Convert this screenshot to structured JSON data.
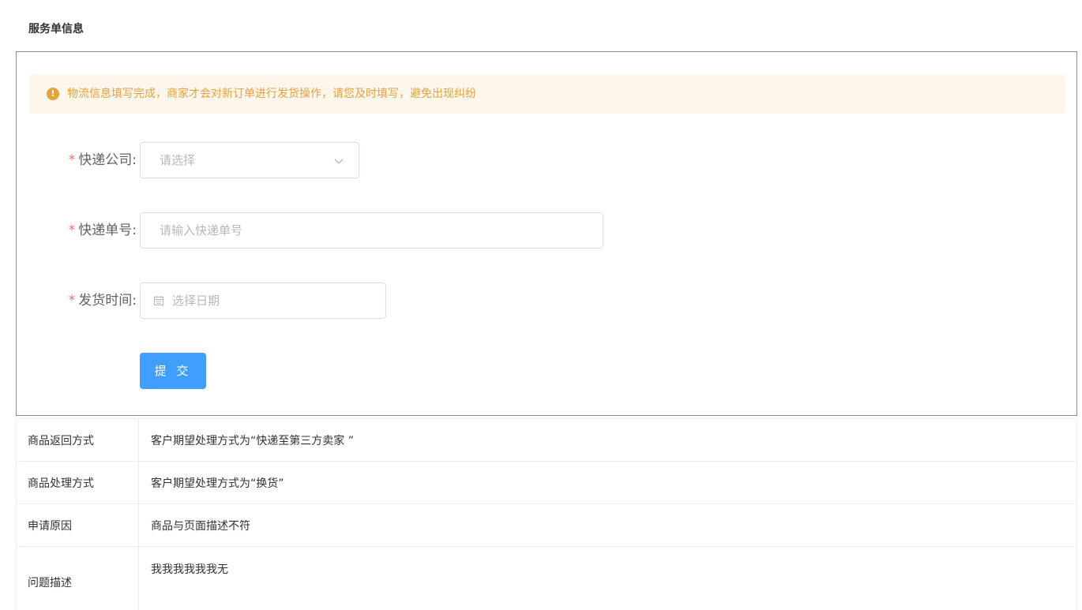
{
  "section": {
    "title": "服务单信息"
  },
  "alert": {
    "icon": "warning-circle-icon",
    "message": "物流信息填写完成，商家才会对新订单进行发货操作，请您及时填写，避免出现纠纷",
    "color": "#e6a23c",
    "background": "#fdf6ec"
  },
  "form": {
    "required_mark": "*",
    "courier_company": {
      "label": "快递公司:",
      "placeholder": "请选择",
      "icon": "chevron-down-icon"
    },
    "tracking_number": {
      "label": "快递单号:",
      "placeholder": "请输入快递单号"
    },
    "ship_time": {
      "label": "发货时间:",
      "placeholder": "选择日期",
      "icon": "calendar-icon"
    },
    "submit_label": "提 交",
    "accent_color": "#409eff"
  },
  "info_table": {
    "rows": [
      {
        "key": "商品返回方式",
        "value": "客户期望处理方式为“快递至第三方卖家 ”"
      },
      {
        "key": "商品处理方式",
        "value": "客户期望处理方式为“换货”"
      },
      {
        "key": "申请原因",
        "value": "商品与页面描述不符"
      },
      {
        "key": "问题描述",
        "value": "我我我我我我无"
      }
    ]
  }
}
